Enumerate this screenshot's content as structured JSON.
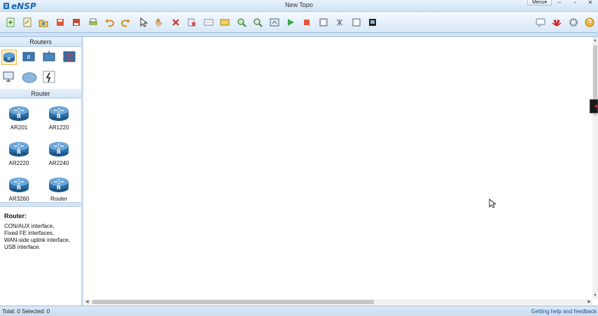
{
  "app": {
    "logo_text": "eNSP",
    "title": "New Topo",
    "menu_label": "Menu▾"
  },
  "left_panel": {
    "category_header": "Routers",
    "section_header": "Router",
    "devices": [
      {
        "label": "AR201"
      },
      {
        "label": "AR1220"
      },
      {
        "label": "AR2220"
      },
      {
        "label": "AR2240"
      },
      {
        "label": "AR3260"
      },
      {
        "label": "Router"
      }
    ],
    "description": {
      "title": "Router:",
      "lines": [
        "CON/AUX interface,",
        "Fixed FE interfaces,",
        "WAN-side uplink interface,",
        "USB interface."
      ]
    }
  },
  "status": {
    "left": "Total: 0  Selected: 0",
    "right": "Getting help and feedback"
  },
  "colors": {
    "accent": "#1a66b2",
    "router_blue": "#2f6fa8",
    "status_link": "#1b4f8c"
  }
}
